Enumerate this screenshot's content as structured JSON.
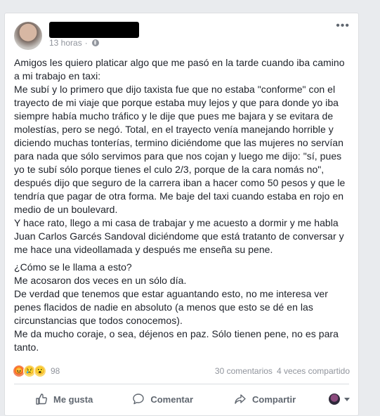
{
  "post": {
    "timestamp": "13 horas",
    "separator": "·",
    "paragraphs": [
      "Amigos les quiero platicar algo que me pasó en la tarde cuando iba camino\na mi trabajo en taxi:\nMe subí y lo primero que dijo taxista fue que no estaba \"conforme\" con el\ntrayecto de mi viaje que porque estaba muy lejos y que para donde yo iba\nsiempre había mucho tráfico y le dije que pues me bajara y se evitara de\nmolestías, pero se negó. Total, en el trayecto venía manejando horrible y\ndiciendo muchas tonterías, termino diciéndome que las mujeres no servían\npara nada que sólo servimos para que nos cojan y luego me dijo: \"sí, pues\nyo te subí sólo porque tienes el culo 2/3, porque de la cara nomás no\",\ndespués dijo que seguro de la carrera iban a hacer como 50 pesos y que le\ntendría que pagar de otra forma. Me baje del taxi cuando estaba en rojo en\nmedio de un boulevard.\nY hace rato, llego a mi casa de trabajar y me acuesto a dormir y me habla\nJuan Carlos Garcés Sandoval diciéndome que está tratanto de conversar y\nme hace una videollamada y después me enseña su pene.",
      "¿Cómo se le llama a esto?\nMe acosaron dos veces en un sólo día.\nDe verdad que tenemos que estar aguantando esto, no me interesa ver\npenes flacidos de nadie en absoluto (a menos que esto se dé en las\ncircunstancias que todos conocemos).\nMe da mucho coraje, o sea, déjenos en paz. Sólo tienen pene, no es para\ntanto."
    ]
  },
  "reactions": {
    "count": "98",
    "icons": [
      "angry-emoji",
      "sad-emoji",
      "wow-emoji"
    ]
  },
  "stats": {
    "comments": "30 comentarios",
    "shares": "4 veces compartido"
  },
  "actions": {
    "like": "Me gusta",
    "comment": "Comentar",
    "share": "Compartir"
  },
  "colors": {
    "background": "#e9ebee",
    "card": "#ffffff",
    "text": "#1d2129",
    "muted": "#90949c",
    "action": "#606770"
  }
}
